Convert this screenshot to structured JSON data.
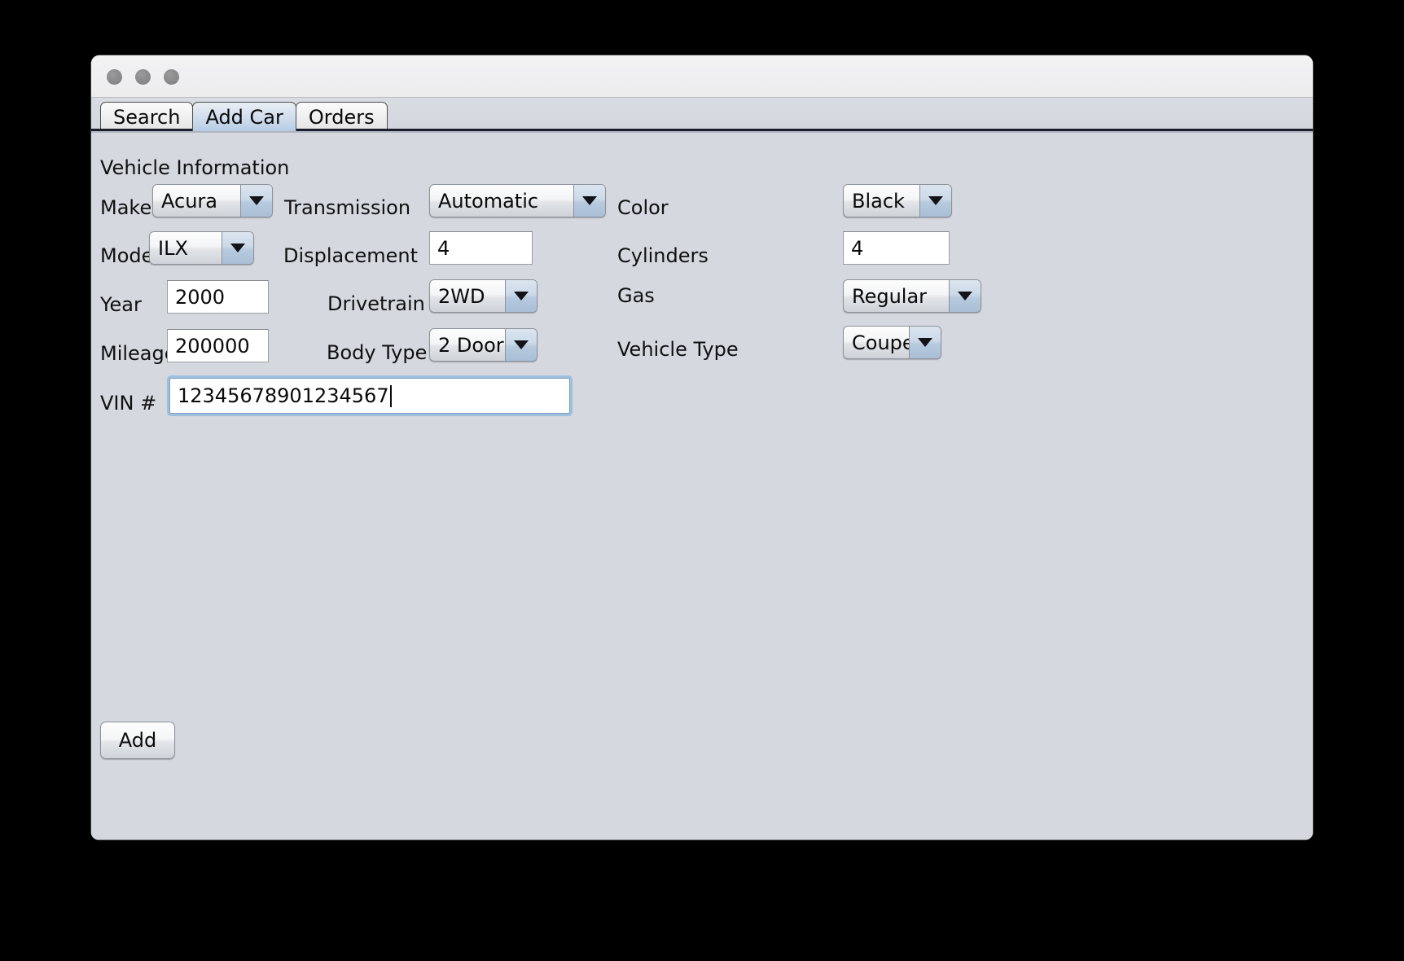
{
  "window": {
    "traffic_lights": [
      "close",
      "minimize",
      "maximize"
    ]
  },
  "tabs": [
    {
      "label": "Search",
      "active": false
    },
    {
      "label": "Add Car",
      "active": true
    },
    {
      "label": "Orders",
      "active": false
    }
  ],
  "section": {
    "title": "Vehicle Information"
  },
  "fields": {
    "make": {
      "label": "Make",
      "value": "Acura"
    },
    "model": {
      "label": "Model",
      "value": "ILX"
    },
    "year": {
      "label": "Year",
      "value": "2000"
    },
    "mileage": {
      "label": "Mileage",
      "value": "200000"
    },
    "vin": {
      "label": "VIN #",
      "value": "12345678901234567"
    },
    "transmission": {
      "label": "Transmission",
      "value": "Automatic"
    },
    "displacement": {
      "label": "Displacement",
      "value": "4"
    },
    "drivetrain": {
      "label": "Drivetrain",
      "value": "2WD"
    },
    "body_type": {
      "label": "Body Type",
      "value": "2 Door"
    },
    "color": {
      "label": "Color",
      "value": "Black"
    },
    "cylinders": {
      "label": "Cylinders",
      "value": "4"
    },
    "gas": {
      "label": "Gas",
      "value": "Regular"
    },
    "vehicle_type": {
      "label": "Vehicle Type",
      "value": "Coupe"
    }
  },
  "actions": {
    "add_label": "Add"
  },
  "icons": {
    "dropdown_arrow": "chevron-down-icon"
  },
  "colors": {
    "desktop": "#000000",
    "window_body": "#d5d8df",
    "titlebar": "#f0f0f1",
    "active_tab": "#b6cde4",
    "focus_ring": "#9fc0dd",
    "field_background": "#ffffff"
  }
}
